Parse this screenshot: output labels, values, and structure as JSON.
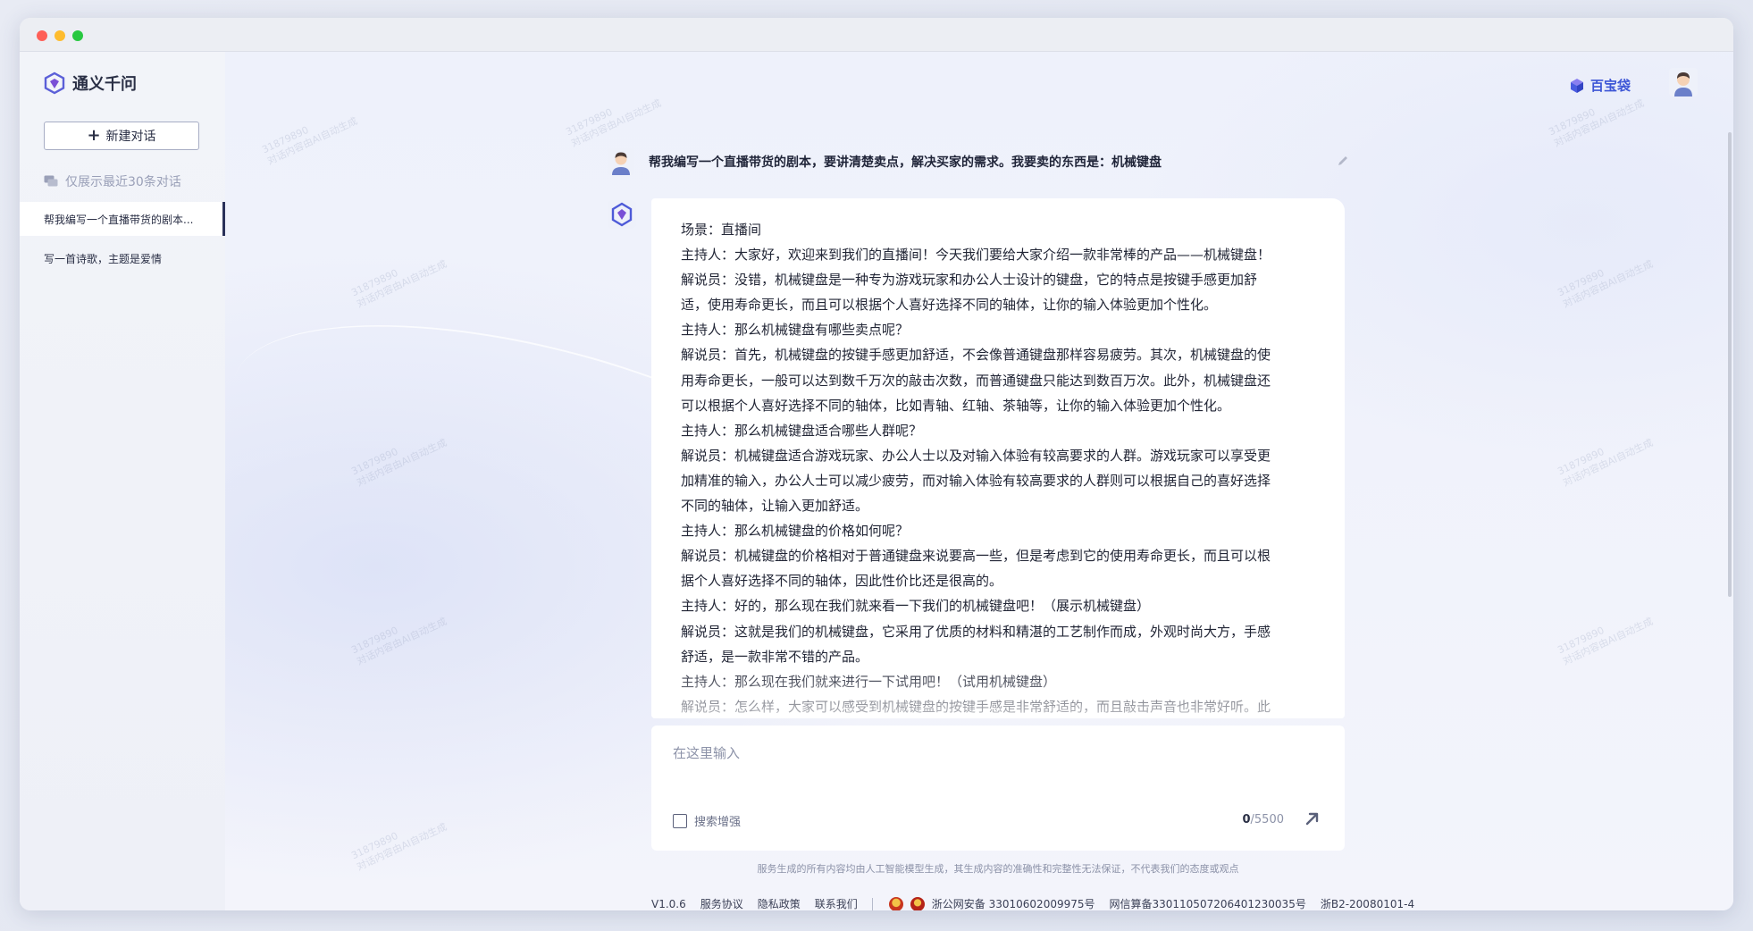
{
  "app": {
    "name": "通义千问",
    "treasure_label": "百宝袋"
  },
  "sidebar": {
    "new_chat_label": "新建对话",
    "recent_note": "仅展示最近30条对话",
    "conversations": [
      {
        "title": "帮我编写一个直播带货的剧本...",
        "active": true
      },
      {
        "title": "写一首诗歌，主题是爱情",
        "active": false
      }
    ]
  },
  "chat": {
    "user_message": "帮我编写一个直播带货的剧本，要讲清楚卖点，解决买家的需求。我要卖的东西是：机械键盘",
    "answer_lines": [
      "场景：直播间",
      "主持人：大家好，欢迎来到我们的直播间！今天我们要给大家介绍一款非常棒的产品——机械键盘！",
      "解说员：没错，机械键盘是一种专为游戏玩家和办公人士设计的键盘，它的特点是按键手感更加舒",
      "适，使用寿命更长，而且可以根据个人喜好选择不同的轴体，让你的输入体验更加个性化。",
      "主持人：那么机械键盘有哪些卖点呢？",
      "解说员：首先，机械键盘的按键手感更加舒适，不会像普通键盘那样容易疲劳。其次，机械键盘的使",
      "用寿命更长，一般可以达到数千万次的敲击次数，而普通键盘只能达到数百万次。此外，机械键盘还",
      "可以根据个人喜好选择不同的轴体，比如青轴、红轴、茶轴等，让你的输入体验更加个性化。",
      "主持人：那么机械键盘适合哪些人群呢？",
      "解说员：机械键盘适合游戏玩家、办公人士以及对输入体验有较高要求的人群。游戏玩家可以享受更",
      "加精准的输入，办公人士可以减少疲劳，而对输入体验有较高要求的人群则可以根据自己的喜好选择",
      "不同的轴体，让输入更加舒适。",
      "主持人：那么机械键盘的价格如何呢？",
      "解说员：机械键盘的价格相对于普通键盘来说要高一些，但是考虑到它的使用寿命更长，而且可以根",
      "据个人喜好选择不同的轴体，因此性价比还是很高的。",
      "主持人：好的，那么现在我们就来看一下我们的机械键盘吧！（展示机械键盘）",
      "解说员：这就是我们的机械键盘，它采用了优质的材料和精湛的工艺制作而成，外观时尚大方，手感",
      "舒适，是一款非常不错的产品。",
      "主持人：那么现在我们就来进行一下试用吧！（试用机械键盘）",
      "解说员：怎么样，大家可以感受到机械键盘的按键手感是非常舒适的，而且敲击声音也非常好听。此"
    ]
  },
  "input": {
    "placeholder": "在这里输入",
    "search_enhance_label": "搜索增强",
    "count_current": "0",
    "count_max": "/5500"
  },
  "footer": {
    "disclaimer": "服务生成的所有内容均由人工智能模型生成，其生成内容的准确性和完整性无法保证，不代表我们的态度或观点",
    "version": "V1.0.6",
    "links": [
      "服务协议",
      "隐私政策",
      "联系我们"
    ],
    "police_record": "浙公网安备 33010602009975号",
    "algorithm_record": "网信算备330110507206401230035号",
    "icp": "浙B2-20080101-4"
  },
  "watermark": {
    "id": "31879890",
    "text": "对话内容由AI自动生成"
  },
  "colors": {
    "accent": "#3d56d6",
    "text_primary": "#1f2438",
    "muted": "#8c92a8"
  }
}
